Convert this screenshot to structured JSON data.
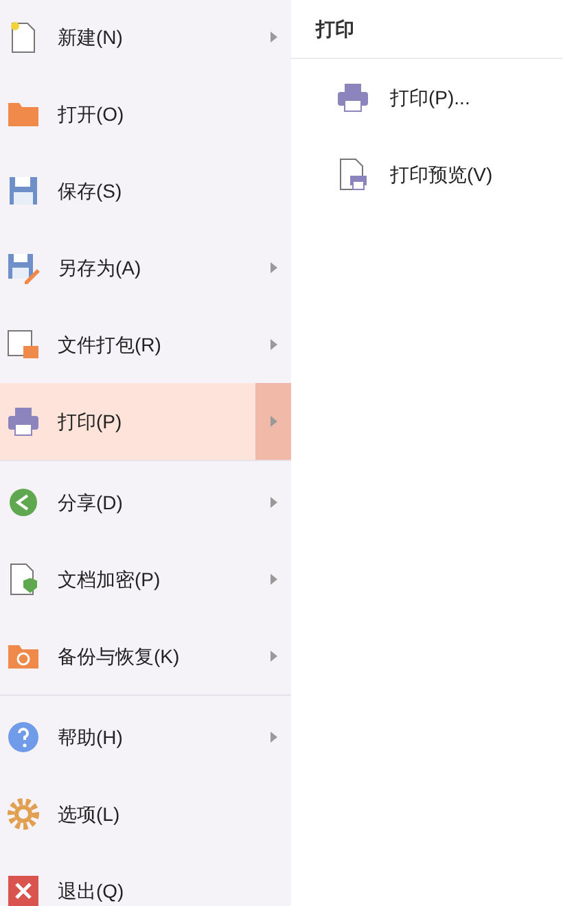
{
  "menu": {
    "groups": [
      [
        {
          "label": "新建(N)",
          "kind": "new",
          "submenu": true,
          "selected": false
        },
        {
          "label": "打开(O)",
          "kind": "open",
          "submenu": false,
          "selected": false
        },
        {
          "label": "保存(S)",
          "kind": "save",
          "submenu": false,
          "selected": false
        },
        {
          "label": "另存为(A)",
          "kind": "saveas",
          "submenu": true,
          "selected": false
        },
        {
          "label": "文件打包(R)",
          "kind": "pack",
          "submenu": true,
          "selected": false
        },
        {
          "label": "打印(P)",
          "kind": "print",
          "submenu": true,
          "selected": true
        }
      ],
      [
        {
          "label": "分享(D)",
          "kind": "share",
          "submenu": true,
          "selected": false
        },
        {
          "label": "文档加密(P)",
          "kind": "encrypt",
          "submenu": true,
          "selected": false
        },
        {
          "label": "备份与恢复(K)",
          "kind": "backup",
          "submenu": true,
          "selected": false
        }
      ],
      [
        {
          "label": "帮助(H)",
          "kind": "help",
          "submenu": true,
          "selected": false
        },
        {
          "label": "选项(L)",
          "kind": "options",
          "submenu": false,
          "selected": false
        },
        {
          "label": "退出(Q)",
          "kind": "exit",
          "submenu": false,
          "selected": false
        }
      ]
    ]
  },
  "submenu": {
    "title": "打印",
    "items": [
      {
        "label": "打印(P)...",
        "kind": "print"
      },
      {
        "label": "打印预览(V)",
        "kind": "preview"
      }
    ]
  }
}
